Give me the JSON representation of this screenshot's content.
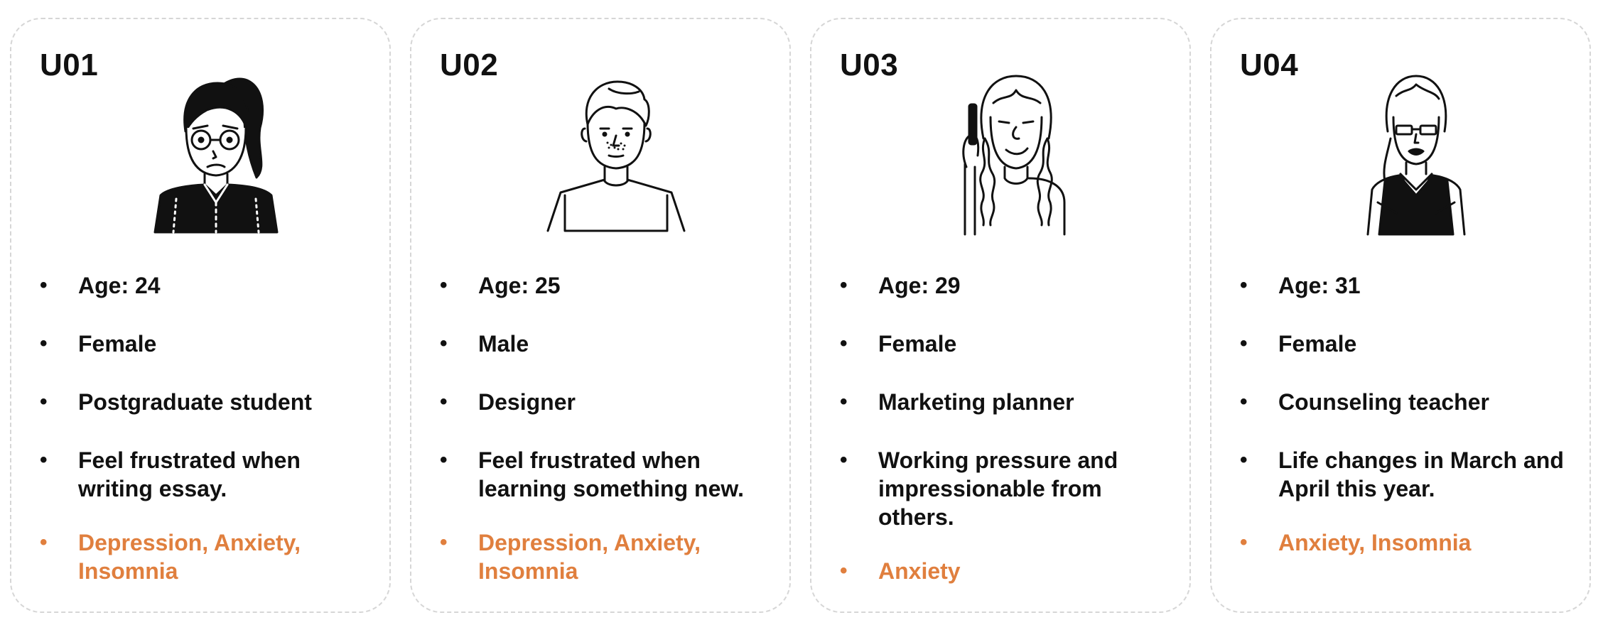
{
  "accent_color": "#e07f3e",
  "users": [
    {
      "id": "U01",
      "avatar_icon": "woman-glasses-ponytail-icon",
      "age": "Age: 24",
      "gender": "Female",
      "occupation": "Postgraduate student",
      "feeling": "Feel frustrated when writing essay.",
      "conditions": "Depression, Anxiety, Insomnia"
    },
    {
      "id": "U02",
      "avatar_icon": "young-man-icon",
      "age": "Age: 25",
      "gender": "Male",
      "occupation": "Designer",
      "feeling": "Feel frustrated when learning something new.",
      "conditions": "Depression, Anxiety, Insomnia"
    },
    {
      "id": "U03",
      "avatar_icon": "woman-braids-phone-icon",
      "age": "Age: 29",
      "gender": "Female",
      "occupation": "Marketing planner",
      "feeling": "Working pressure and impressionable from others.",
      "conditions": "Anxiety"
    },
    {
      "id": "U04",
      "avatar_icon": "woman-glasses-vest-icon",
      "age": "Age: 31",
      "gender": "Female",
      "occupation": "Counseling teacher",
      "feeling": "Life changes in March and April this year.",
      "conditions": "Anxiety, Insomnia"
    }
  ]
}
